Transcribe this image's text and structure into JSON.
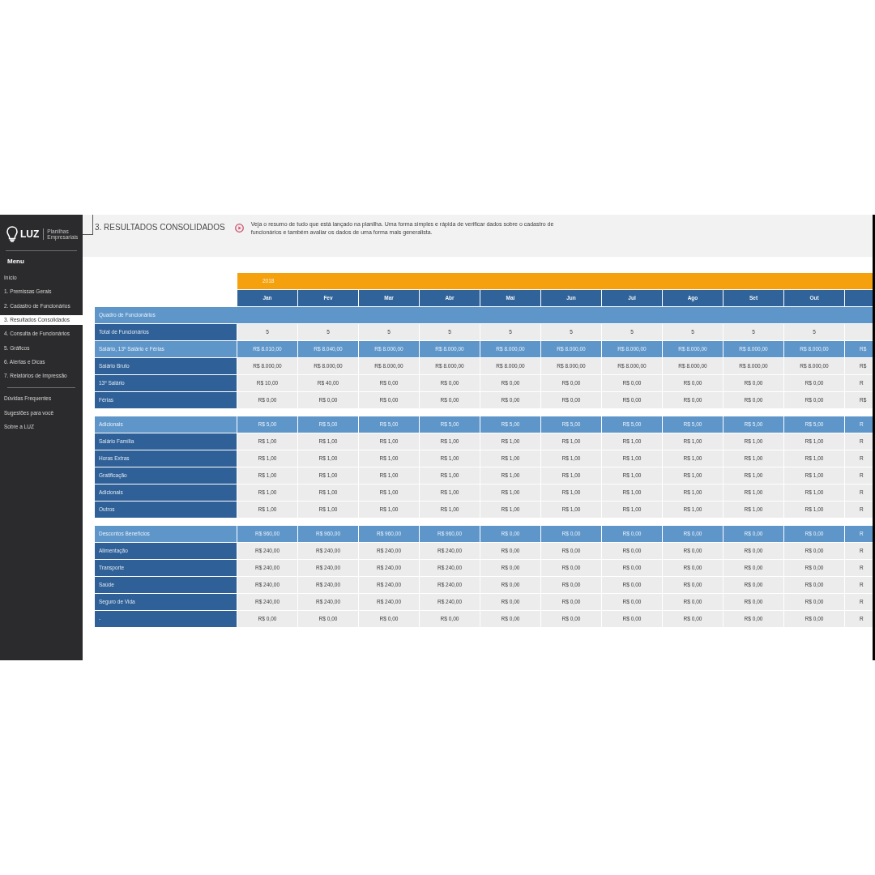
{
  "sidebar": {
    "logo": {
      "name": "LUZ",
      "tagline": "Planilhas Empresariais"
    },
    "menu_title": "Menu",
    "items": [
      {
        "label": "Início",
        "selected": false
      },
      {
        "label": "1. Premissas Gerais",
        "selected": false
      },
      {
        "label": "2. Cadastro de Funcionários",
        "selected": false
      },
      {
        "label": "3. Resultados Consolidados",
        "selected": true
      },
      {
        "label": "4. Consulta de Funcionários",
        "selected": false
      },
      {
        "label": "5. Gráficos",
        "selected": false
      },
      {
        "label": "6. Alertas e Dicas",
        "selected": false
      },
      {
        "label": "7. Relatórios de Impressão",
        "selected": false
      }
    ],
    "extra_items": [
      {
        "label": "Dúvidas Frequentes",
        "selected": false
      },
      {
        "label": "Sugestões para você",
        "selected": false
      },
      {
        "label": "Sobre a LUZ",
        "selected": false
      }
    ]
  },
  "header": {
    "title": "3. RESULTADOS CONSOLIDADOS",
    "description": "Veja o resumo de tudo que está lançado na planilha. Uma forma simples e rápida de verificar dados sobre o cadastro de funcionários e também avaliar os dados de uma forma mais generalista."
  },
  "table": {
    "year": "2018",
    "months": [
      "Jan",
      "Fev",
      "Mar",
      "Abr",
      "Mai",
      "Jun",
      "Jul",
      "Ago",
      "Set",
      "Out"
    ],
    "sections": [
      {
        "rows": [
          {
            "kind": "band",
            "label": "Quadro de Funcionários"
          },
          {
            "kind": "data",
            "label": "Total de Funcionários",
            "values": [
              "5",
              "5",
              "5",
              "5",
              "5",
              "5",
              "5",
              "5",
              "5",
              "5"
            ]
          },
          {
            "kind": "total",
            "label": "Salário, 13º Salário e Férias",
            "values": [
              "R$ 8.010,00",
              "R$ 8.040,00",
              "R$ 8.000,00",
              "R$ 8.000,00",
              "R$ 8.000,00",
              "R$ 8.000,00",
              "R$ 8.000,00",
              "R$ 8.000,00",
              "R$ 8.000,00",
              "R$ 8.000,00",
              "R$"
            ]
          },
          {
            "kind": "data",
            "label": "Salário Bruto",
            "values": [
              "R$ 8.000,00",
              "R$ 8.000,00",
              "R$ 8.000,00",
              "R$ 8.000,00",
              "R$ 8.000,00",
              "R$ 8.000,00",
              "R$ 8.000,00",
              "R$ 8.000,00",
              "R$ 8.000,00",
              "R$ 8.000,00",
              "R$"
            ]
          },
          {
            "kind": "data",
            "label": "13º Salário",
            "values": [
              "R$ 10,00",
              "R$ 40,00",
              "R$ 0,00",
              "R$ 0,00",
              "R$ 0,00",
              "R$ 0,00",
              "R$ 0,00",
              "R$ 0,00",
              "R$ 0,00",
              "R$ 0,00",
              "R"
            ]
          },
          {
            "kind": "data",
            "label": "Férias",
            "values": [
              "R$ 0,00",
              "R$ 0,00",
              "R$ 0,00",
              "R$ 0,00",
              "R$ 0,00",
              "R$ 0,00",
              "R$ 0,00",
              "R$ 0,00",
              "R$ 0,00",
              "R$ 0,00",
              "R$"
            ]
          }
        ]
      },
      {
        "rows": [
          {
            "kind": "total",
            "label": "Adicionais",
            "values": [
              "R$ 5,00",
              "R$ 5,00",
              "R$ 5,00",
              "R$ 5,00",
              "R$ 5,00",
              "R$ 5,00",
              "R$ 5,00",
              "R$ 5,00",
              "R$ 5,00",
              "R$ 5,00",
              "R"
            ]
          },
          {
            "kind": "data",
            "label": "Salário Família",
            "values": [
              "R$ 1,00",
              "R$ 1,00",
              "R$ 1,00",
              "R$ 1,00",
              "R$ 1,00",
              "R$ 1,00",
              "R$ 1,00",
              "R$ 1,00",
              "R$ 1,00",
              "R$ 1,00",
              "R"
            ]
          },
          {
            "kind": "data",
            "label": "Horas Extras",
            "values": [
              "R$ 1,00",
              "R$ 1,00",
              "R$ 1,00",
              "R$ 1,00",
              "R$ 1,00",
              "R$ 1,00",
              "R$ 1,00",
              "R$ 1,00",
              "R$ 1,00",
              "R$ 1,00",
              "R"
            ]
          },
          {
            "kind": "data",
            "label": "Gratificação",
            "values": [
              "R$ 1,00",
              "R$ 1,00",
              "R$ 1,00",
              "R$ 1,00",
              "R$ 1,00",
              "R$ 1,00",
              "R$ 1,00",
              "R$ 1,00",
              "R$ 1,00",
              "R$ 1,00",
              "R"
            ]
          },
          {
            "kind": "data",
            "label": "Adicionais",
            "values": [
              "R$ 1,00",
              "R$ 1,00",
              "R$ 1,00",
              "R$ 1,00",
              "R$ 1,00",
              "R$ 1,00",
              "R$ 1,00",
              "R$ 1,00",
              "R$ 1,00",
              "R$ 1,00",
              "R"
            ]
          },
          {
            "kind": "data",
            "label": "Outros",
            "values": [
              "R$ 1,00",
              "R$ 1,00",
              "R$ 1,00",
              "R$ 1,00",
              "R$ 1,00",
              "R$ 1,00",
              "R$ 1,00",
              "R$ 1,00",
              "R$ 1,00",
              "R$ 1,00",
              "R"
            ]
          }
        ]
      },
      {
        "rows": [
          {
            "kind": "total",
            "label": "Descontos Benefícios",
            "values": [
              "R$ 960,00",
              "R$ 960,00",
              "R$ 960,00",
              "R$ 960,00",
              "R$ 0,00",
              "R$ 0,00",
              "R$ 0,00",
              "R$ 0,00",
              "R$ 0,00",
              "R$ 0,00",
              "R"
            ]
          },
          {
            "kind": "data",
            "label": "Alimentação",
            "values": [
              "R$ 240,00",
              "R$ 240,00",
              "R$ 240,00",
              "R$ 240,00",
              "R$ 0,00",
              "R$ 0,00",
              "R$ 0,00",
              "R$ 0,00",
              "R$ 0,00",
              "R$ 0,00",
              "R"
            ]
          },
          {
            "kind": "data",
            "label": "Transporte",
            "values": [
              "R$ 240,00",
              "R$ 240,00",
              "R$ 240,00",
              "R$ 240,00",
              "R$ 0,00",
              "R$ 0,00",
              "R$ 0,00",
              "R$ 0,00",
              "R$ 0,00",
              "R$ 0,00",
              "R"
            ]
          },
          {
            "kind": "data",
            "label": "Saúde",
            "values": [
              "R$ 240,00",
              "R$ 240,00",
              "R$ 240,00",
              "R$ 240,00",
              "R$ 0,00",
              "R$ 0,00",
              "R$ 0,00",
              "R$ 0,00",
              "R$ 0,00",
              "R$ 0,00",
              "R"
            ]
          },
          {
            "kind": "data",
            "label": "Seguro de Vida",
            "values": [
              "R$ 240,00",
              "R$ 240,00",
              "R$ 240,00",
              "R$ 240,00",
              "R$ 0,00",
              "R$ 0,00",
              "R$ 0,00",
              "R$ 0,00",
              "R$ 0,00",
              "R$ 0,00",
              "R"
            ]
          },
          {
            "kind": "data",
            "label": "-",
            "values": [
              "R$ 0,00",
              "R$ 0,00",
              "R$ 0,00",
              "R$ 0,00",
              "R$ 0,00",
              "R$ 0,00",
              "R$ 0,00",
              "R$ 0,00",
              "R$ 0,00",
              "R$ 0,00",
              "R"
            ]
          }
        ]
      }
    ]
  }
}
